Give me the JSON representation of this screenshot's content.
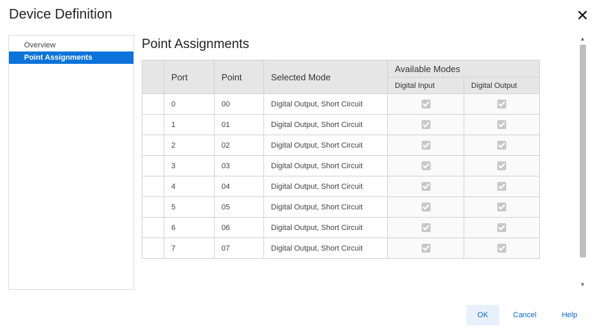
{
  "dialog": {
    "title": "Device Definition",
    "close_glyph": "✕"
  },
  "nav": {
    "items": [
      {
        "label": "Overview",
        "active": false
      },
      {
        "label": "Point Assignments",
        "active": true
      }
    ]
  },
  "main": {
    "title": "Point Assignments",
    "table": {
      "headers": {
        "port": "Port",
        "point": "Point",
        "selected_mode": "Selected Mode",
        "available_modes": "Available Modes",
        "digital_input": "Digital Input",
        "digital_output": "Digital Output"
      },
      "rows": [
        {
          "port": "0",
          "point": "00",
          "mode": "Digital Output, Short Circuit",
          "digital_input": true,
          "digital_output": true
        },
        {
          "port": "1",
          "point": "01",
          "mode": "Digital Output, Short Circuit",
          "digital_input": true,
          "digital_output": true
        },
        {
          "port": "2",
          "point": "02",
          "mode": "Digital Output, Short Circuit",
          "digital_input": true,
          "digital_output": true
        },
        {
          "port": "3",
          "point": "03",
          "mode": "Digital Output, Short Circuit",
          "digital_input": true,
          "digital_output": true
        },
        {
          "port": "4",
          "point": "04",
          "mode": "Digital Output, Short Circuit",
          "digital_input": true,
          "digital_output": true
        },
        {
          "port": "5",
          "point": "05",
          "mode": "Digital Output, Short Circuit",
          "digital_input": true,
          "digital_output": true
        },
        {
          "port": "6",
          "point": "06",
          "mode": "Digital Output, Short Circuit",
          "digital_input": true,
          "digital_output": true
        },
        {
          "port": "7",
          "point": "07",
          "mode": "Digital Output, Short Circuit",
          "digital_input": true,
          "digital_output": true
        }
      ]
    }
  },
  "footer": {
    "ok_label": "OK",
    "cancel_label": "Cancel",
    "help_label": "Help"
  },
  "colors": {
    "accent": "#0b73d9",
    "link": "#0b67c9",
    "header_bg": "#e6e6e6"
  }
}
